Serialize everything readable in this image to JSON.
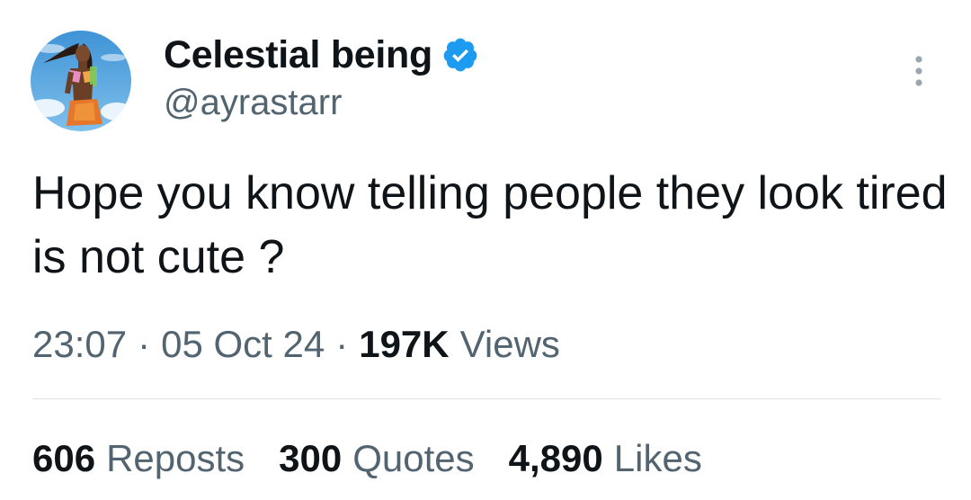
{
  "author": {
    "display_name": "Celestial being",
    "handle": "@ayrastarr",
    "verified": true,
    "verified_color": "#1d9bf0",
    "avatar": "profile-photo"
  },
  "more_icon": "more-vertical-icon",
  "tweet": {
    "text": "Hope you know telling people they look tired is not cute ?"
  },
  "meta": {
    "time": "23:07",
    "separator": "·",
    "date": "05 Oct 24",
    "views_count": "197K",
    "views_label": "Views"
  },
  "stats": [
    {
      "count": "606",
      "label": "Reposts"
    },
    {
      "count": "300",
      "label": "Quotes"
    },
    {
      "count": "4,890",
      "label": "Likes"
    }
  ],
  "colors": {
    "primary_text": "#0f1419",
    "secondary_text": "#536471",
    "divider": "#dde3e7"
  }
}
